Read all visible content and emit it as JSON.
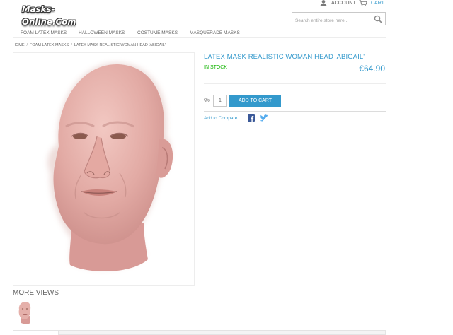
{
  "header": {
    "logo_text": "Masks-Online.Com",
    "account_label": "ACCOUNT",
    "cart_label": "CART",
    "search_placeholder": "Search entire store here..."
  },
  "nav": {
    "items": [
      {
        "label": "FOAM LATEX MASKS"
      },
      {
        "label": "HALLOWEEN MASKS"
      },
      {
        "label": "COSTUME MASKS"
      },
      {
        "label": "MASQUERADE MASKS"
      }
    ]
  },
  "breadcrumb": {
    "items": [
      "HOME",
      "FOAM LATEX MASKS",
      "LATEX MASK REALISTIC WOMAN HEAD 'ABIGAIL'"
    ]
  },
  "product": {
    "title": "LATEX MASK REALISTIC WOMAN HEAD 'ABIGAIL'",
    "stock": "IN STOCK",
    "price": "€64.90",
    "qty_label": "Qty",
    "qty_value": "1",
    "add_to_cart_label": "ADD TO CART",
    "compare_label": "Add to Compare"
  },
  "more_views": {
    "heading": "MORE VIEWS"
  },
  "icons": {
    "account": "user-icon",
    "cart": "cart-icon",
    "search": "search-icon",
    "facebook": "facebook-icon",
    "twitter": "twitter-icon"
  },
  "colors": {
    "accent": "#3399cc",
    "in_stock": "#11b400",
    "text": "#636363"
  }
}
